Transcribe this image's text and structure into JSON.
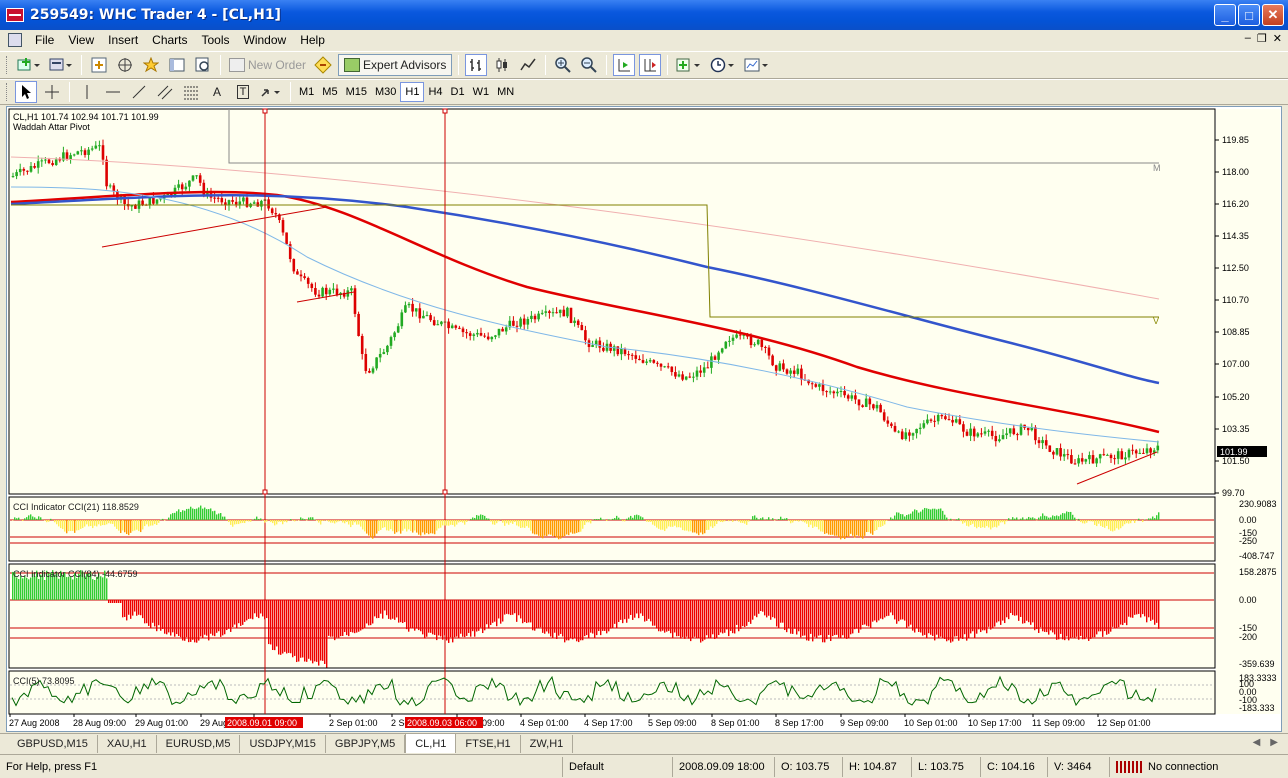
{
  "window": {
    "title": "259549: WHC Trader 4 - [CL,H1]"
  },
  "menu": [
    "File",
    "View",
    "Insert",
    "Charts",
    "Tools",
    "Window",
    "Help"
  ],
  "toolbar": {
    "new_order": "New Order",
    "expert_advisors": "Expert Advisors"
  },
  "draw_tools": {
    "text_a": "A",
    "text_t": "T"
  },
  "timeframes": [
    "M1",
    "M5",
    "M15",
    "M30",
    "H1",
    "H4",
    "D1",
    "W1",
    "MN"
  ],
  "active_timeframe": "H1",
  "chart": {
    "symbol_info": "CL,H1  101.74 102.94 101.71 101.99",
    "indicator_name": "Waddah Attar Pivot",
    "price_axis": [
      "119.85",
      "118.00",
      "116.20",
      "114.35",
      "112.50",
      "110.70",
      "108.85",
      "107.00",
      "105.20",
      "103.35",
      "101.50",
      "99.70"
    ],
    "current_price": "101.99",
    "pivot_labels": {
      "m": "M",
      "v": "V"
    },
    "cci1": {
      "label": "CCI Indicator  CCI(21) 118.8529",
      "axis": [
        "230.9083",
        "0.00",
        "-150",
        "-250",
        "-408.747"
      ]
    },
    "cci2": {
      "label": "CCI Indicator  CCI(84) -44.6759",
      "axis": [
        "158.2875",
        "0.00",
        "-150",
        "-200",
        "-359.639"
      ]
    },
    "cci3": {
      "label": "CCI(5) 73.8095",
      "axis": [
        "183.3333",
        "100",
        "0.00",
        "-100",
        "-183.333"
      ]
    },
    "time_axis": [
      "27 Aug 2008",
      "28 Aug 09:00",
      "29 Aug 01:00",
      "29 Aug 17:00",
      "1 Sep 09:00",
      "2 Sep 01:00",
      "2 Sep 17:00",
      "3 Sep 09:00",
      "4 Sep 01:00",
      "4 Sep 17:00",
      "5 Sep 09:00",
      "8 Sep 01:00",
      "8 Sep 17:00",
      "9 Sep 09:00",
      "10 Sep 01:00",
      "10 Sep 17:00",
      "11 Sep 09:00",
      "12 Sep 01:00"
    ],
    "vline_labels": [
      "2008.09.01 09:00",
      "2008.09.03 06:00"
    ]
  },
  "tabs": [
    "GBPUSD,M15",
    "XAU,H1",
    "EURUSD,M5",
    "USDJPY,M15",
    "GBPJPY,M5",
    "CL,H1",
    "FTSE,H1",
    "ZW,H1"
  ],
  "active_tab": "CL,H1",
  "status": {
    "help": "For Help, press F1",
    "profile": "Default",
    "datetime": "2008.09.09 18:00",
    "open": "O: 103.75",
    "high": "H: 104.87",
    "low": "L: 103.75",
    "close": "C: 104.16",
    "volume": "V: 3464",
    "connection": "No connection"
  },
  "colors": {
    "bull": "#22aa22",
    "bear": "#dd0000",
    "ma_red": "#e00000",
    "ma_blue": "#3355cc",
    "cci_orange": "#ff9900",
    "cci_red": "#ee0000",
    "cci_green": "#33cc33",
    "background": "#fffff0"
  }
}
